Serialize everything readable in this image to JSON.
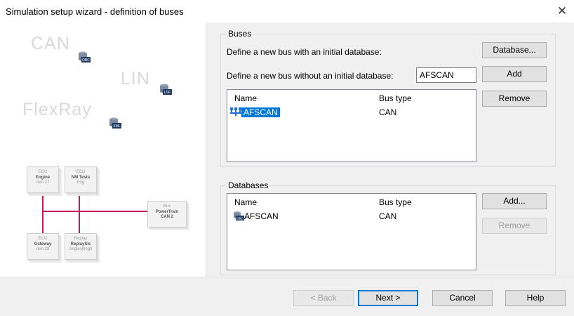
{
  "window": {
    "title": "Simulation setup wizard - definition of buses",
    "close_glyph": "✕"
  },
  "illustration": {
    "bus_words": [
      "CAN",
      "LIN",
      "FlexRay"
    ],
    "db_badges": [
      "DBC",
      "LDF",
      "XML"
    ],
    "ecus": [
      {
        "line1": "ECU",
        "line2": "Engine",
        "line3": "rem 27"
      },
      {
        "line1": "ECU",
        "line2": "NM Tests",
        "line3": "frog"
      },
      {
        "line1": "Bus",
        "line2": "PowerTrain",
        "line3": "CAN 2"
      },
      {
        "line1": "ECU",
        "line2": "Gateway",
        "line3": "rem 28"
      },
      {
        "line1": "Replay",
        "line2": "ReplaySlc",
        "line3": "Sngleshlogh"
      }
    ]
  },
  "buses": {
    "group_title": "Buses",
    "label_with_db": "Define a new bus with an initial database:",
    "label_without_db": "Define a new bus without an initial database:",
    "new_bus_value": "AFSCAN",
    "database_button": "Database...",
    "add_button": "Add",
    "remove_button": "Remove",
    "columns": [
      "Name",
      "Bus type"
    ],
    "rows": [
      {
        "name": "AFSCAN",
        "type": "CAN",
        "selected": true
      }
    ]
  },
  "databases": {
    "group_title": "Databases",
    "add_button": "Add...",
    "remove_button": "Remove",
    "columns": [
      "Name",
      "Bus type"
    ],
    "rows": [
      {
        "name": "AFSCAN",
        "type": "CAN",
        "icon": "dbc-database-icon",
        "badge": "DBC"
      }
    ]
  },
  "footer": {
    "back": "< Back",
    "next": "Next >",
    "cancel": "Cancel",
    "help": "Help"
  },
  "colors": {
    "selection": "#0078d7",
    "bus_wire": "#c2185b",
    "dialog_bg": "#f0f0f0"
  }
}
